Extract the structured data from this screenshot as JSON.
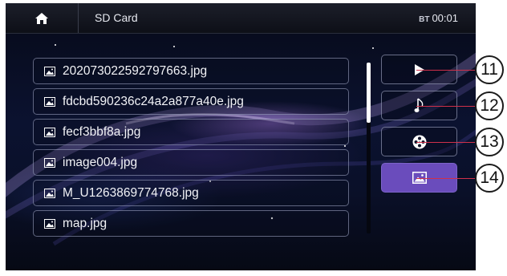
{
  "header": {
    "home_icon": "home-icon",
    "title": "SD Card",
    "bt_label": "BT",
    "time": "00:01"
  },
  "files": [
    {
      "name": "202073022592797663.jpg",
      "icon": "image-icon"
    },
    {
      "name": "fdcbd590236c24a2a877a40e.jpg",
      "icon": "image-icon"
    },
    {
      "name": "fecf3bbf8a.jpg",
      "icon": "image-icon"
    },
    {
      "name": "image004.jpg",
      "icon": "image-icon"
    },
    {
      "name": "M_U1263869774768.jpg",
      "icon": "image-icon"
    },
    {
      "name": "map.jpg",
      "icon": "image-icon"
    }
  ],
  "modes": [
    {
      "icon": "play-icon",
      "active": false,
      "callout": "11"
    },
    {
      "icon": "music-note-icon",
      "active": false,
      "callout": "12"
    },
    {
      "icon": "film-reel-icon",
      "active": false,
      "callout": "13"
    },
    {
      "icon": "picture-icon",
      "active": true,
      "callout": "14"
    }
  ],
  "colors": {
    "active_mode": "#6a4cbc",
    "callout_line": "#d0304a",
    "background": "#0b1230"
  }
}
